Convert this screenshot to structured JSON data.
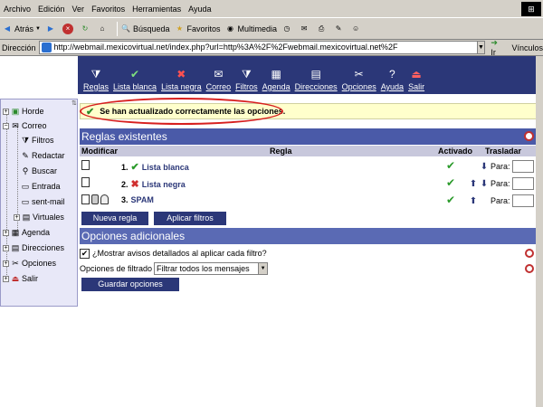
{
  "browser": {
    "menu": [
      "Archivo",
      "Edición",
      "Ver",
      "Favoritos",
      "Herramientas",
      "Ayuda"
    ],
    "toolbar": {
      "back": "Atrás",
      "search": "Búsqueda",
      "favorites": "Favoritos",
      "multimedia": "Multimedia"
    },
    "address_label": "Dirección",
    "address": "http://webmail.mexicovirtual.net/index.php?url=http%3A%2F%2Fwebmail.mexicovirtual.net%2F",
    "go": "Ir",
    "links": "Vínculos"
  },
  "nav": {
    "items": [
      {
        "label": "Reglas",
        "icon": "filter-icon"
      },
      {
        "label": "Lista blanca",
        "icon": "check-icon"
      },
      {
        "label": "Lista negra",
        "icon": "x-icon"
      },
      {
        "label": "Correo",
        "icon": "mail-icon"
      },
      {
        "label": "Filtros",
        "icon": "filter-icon"
      },
      {
        "label": "Agenda",
        "icon": "calendar-icon"
      },
      {
        "label": "Direcciones",
        "icon": "address-book-icon"
      },
      {
        "label": "Opciones",
        "icon": "tools-icon"
      },
      {
        "label": "Ayuda",
        "icon": "help-icon"
      },
      {
        "label": "Salir",
        "icon": "exit-icon"
      }
    ]
  },
  "sidebar": {
    "horde": "Horde",
    "correo": "Correo",
    "filtros": "Filtros",
    "redactar": "Redactar",
    "buscar": "Buscar",
    "entrada": "Entrada",
    "sentmail": "sent-mail",
    "virtuales": "Virtuales",
    "agenda": "Agenda",
    "direcciones": "Direcciones",
    "opciones": "Opciones",
    "salir": "Salir"
  },
  "notice": "Se han actualizado correctamente las opciones.",
  "rules": {
    "title": "Reglas existentes",
    "headers": {
      "modify": "Modificar",
      "rule": "Regla",
      "active": "Activado",
      "move": "Trasladar"
    },
    "rows": [
      {
        "num": "1.",
        "name": "Lista blanca",
        "icon": "check-icon"
      },
      {
        "num": "2.",
        "name": "Lista negra",
        "icon": "x-icon"
      },
      {
        "num": "3.",
        "name": "SPAM",
        "icon": ""
      }
    ],
    "para": "Para:",
    "new_rule": "Nueva regla",
    "apply": "Aplicar filtros"
  },
  "options": {
    "title": "Opciones adicionales",
    "show_details": "¿Mostrar avisos detallados al aplicar cada filtro?",
    "filter_label": "Opciones de filtrado",
    "filter_value": "Filtrar todos los mensajes",
    "save": "Guardar opciones"
  }
}
